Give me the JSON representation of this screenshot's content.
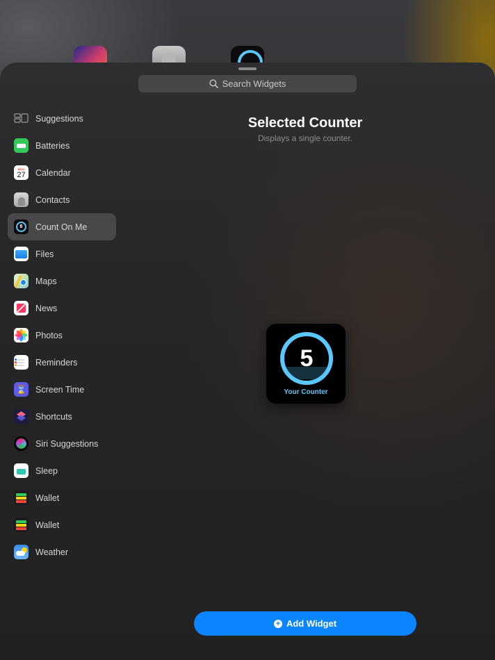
{
  "search": {
    "placeholder": "Search Widgets"
  },
  "sidebar": {
    "items": [
      {
        "label": "Suggestions",
        "icon": "suggestions-icon"
      },
      {
        "label": "Batteries",
        "icon": "batteries-app-icon"
      },
      {
        "label": "Calendar",
        "icon": "calendar-app-icon",
        "icon_month": "MON",
        "icon_day": "27"
      },
      {
        "label": "Contacts",
        "icon": "contacts-app-icon"
      },
      {
        "label": "Count On Me",
        "icon": "count-on-me-app-icon",
        "icon_value": "8",
        "selected": true
      },
      {
        "label": "Files",
        "icon": "files-app-icon"
      },
      {
        "label": "Maps",
        "icon": "maps-app-icon"
      },
      {
        "label": "News",
        "icon": "news-app-icon"
      },
      {
        "label": "Photos",
        "icon": "photos-app-icon"
      },
      {
        "label": "Reminders",
        "icon": "reminders-app-icon"
      },
      {
        "label": "Screen Time",
        "icon": "screen-time-app-icon"
      },
      {
        "label": "Shortcuts",
        "icon": "shortcuts-app-icon"
      },
      {
        "label": "Siri Suggestions",
        "icon": "siri-icon"
      },
      {
        "label": "Sleep",
        "icon": "sleep-app-icon"
      },
      {
        "label": "Wallet",
        "icon": "wallet-app-icon"
      },
      {
        "label": "Wallet",
        "icon": "wallet-app-icon"
      },
      {
        "label": "Weather",
        "icon": "weather-app-icon"
      }
    ]
  },
  "preview": {
    "title": "Selected Counter",
    "subtitle": "Displays a single counter.",
    "widget": {
      "value": "5",
      "caption": "Your Counter"
    }
  },
  "actions": {
    "add_widget_label": "Add Widget"
  },
  "colors": {
    "accent": "#0a84ff",
    "counter_ring": "#5ac8fa",
    "selected_row": "#48484a"
  }
}
